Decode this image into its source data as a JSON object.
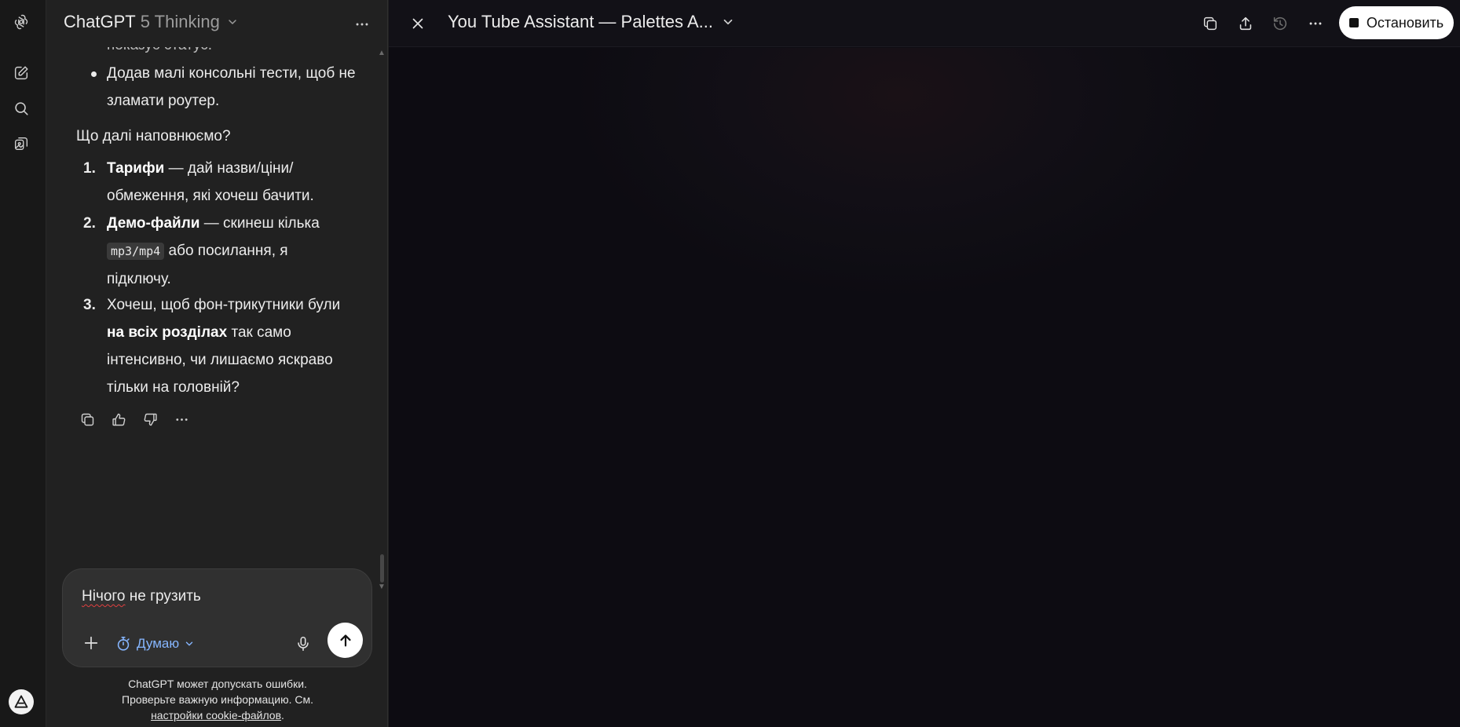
{
  "app": {
    "name": "ChatGPT"
  },
  "rail": {
    "items": [
      {
        "icon": "openai-logo-icon"
      },
      {
        "icon": "new-chat-icon"
      },
      {
        "icon": "search-icon"
      },
      {
        "icon": "library-icon"
      }
    ],
    "bottom_icon": "account-avatar-icon"
  },
  "chat": {
    "model_name": "ChatGPT",
    "model_version": "5 Thinking",
    "message": {
      "cut_line": "показує статус.",
      "bullet": "Додав малі консольні тести, щоб не зламати роутер.",
      "question": "Що далі наповнюємо?",
      "items": [
        {
          "num": "1.",
          "bold": "Тарифи",
          "text_a": " — дай назви/ціни/",
          "text_b": "обмеження, які хочеш бачити."
        },
        {
          "num": "2.",
          "bold": "Демо-файли",
          "text_a": " — скинеш кілька",
          "code": "mp3/mp4",
          "text_b": " або посилання, я",
          "text_c": "підключу."
        },
        {
          "num": "3.",
          "text_a": "Хочеш, щоб фон-трикутники були",
          "bold": "на всіх розділах",
          "text_b": " так само",
          "text_c": "інтенсивно, чи лишаємо яскраво",
          "text_d": "тільки на головній?"
        }
      ]
    },
    "composer": {
      "word_1": "Нічого",
      "rest": " не грузить",
      "think_label": "Думаю"
    },
    "disclaimer": {
      "line1": "ChatGPT может допускать ошибки.",
      "line2": "Проверьте важную информацию. См.",
      "link": "настройки cookie-файлов",
      "end": "."
    }
  },
  "canvas": {
    "title": "You Tube Assistant — Palettes A...",
    "stop_label": "Остановить"
  },
  "colors": {
    "accent_blue": "#86b6ff",
    "canvas_bg": "#0e0d13",
    "chat_bg": "#212121"
  }
}
